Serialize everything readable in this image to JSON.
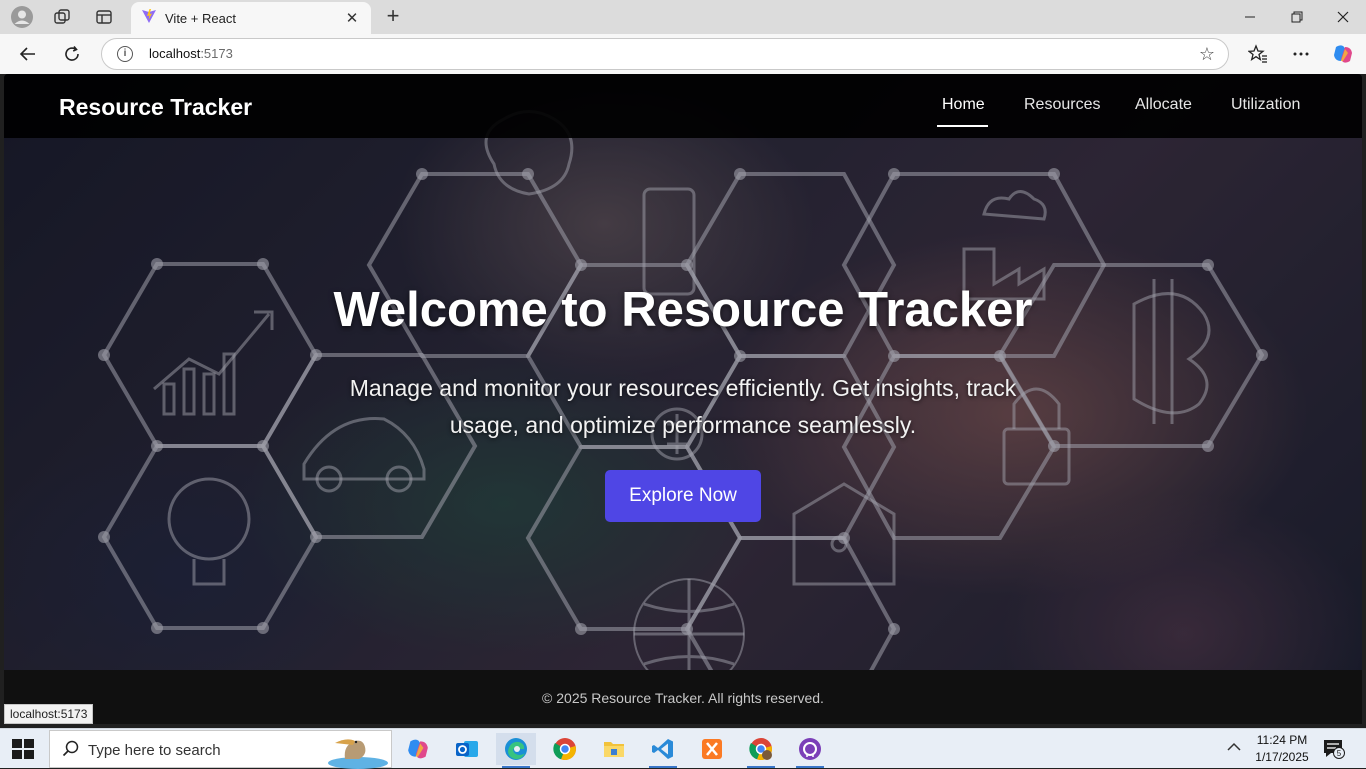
{
  "browser": {
    "tab_title": "Vite + React",
    "address_host": "localhost",
    "address_port": ":5173",
    "status_url": "localhost:5173"
  },
  "site": {
    "brand": "Resource Tracker",
    "nav": [
      {
        "label": "Home",
        "active": true
      },
      {
        "label": "Resources",
        "active": false
      },
      {
        "label": "Allocate",
        "active": false
      },
      {
        "label": "Utilization",
        "active": false
      }
    ],
    "hero": {
      "title": "Welcome to Resource Tracker",
      "subtitle": "Manage and monitor your resources efficiently. Get insights, track usage, and optimize performance seamlessly.",
      "cta": "Explore Now"
    },
    "footer": "© 2025 Resource Tracker. All rights reserved."
  },
  "taskbar": {
    "search_placeholder": "Type here to search",
    "time": "11:24 PM",
    "date": "1/17/2025",
    "notification_count": "5"
  },
  "colors": {
    "accent": "#4f46e5",
    "nav_bg": "#000000"
  }
}
